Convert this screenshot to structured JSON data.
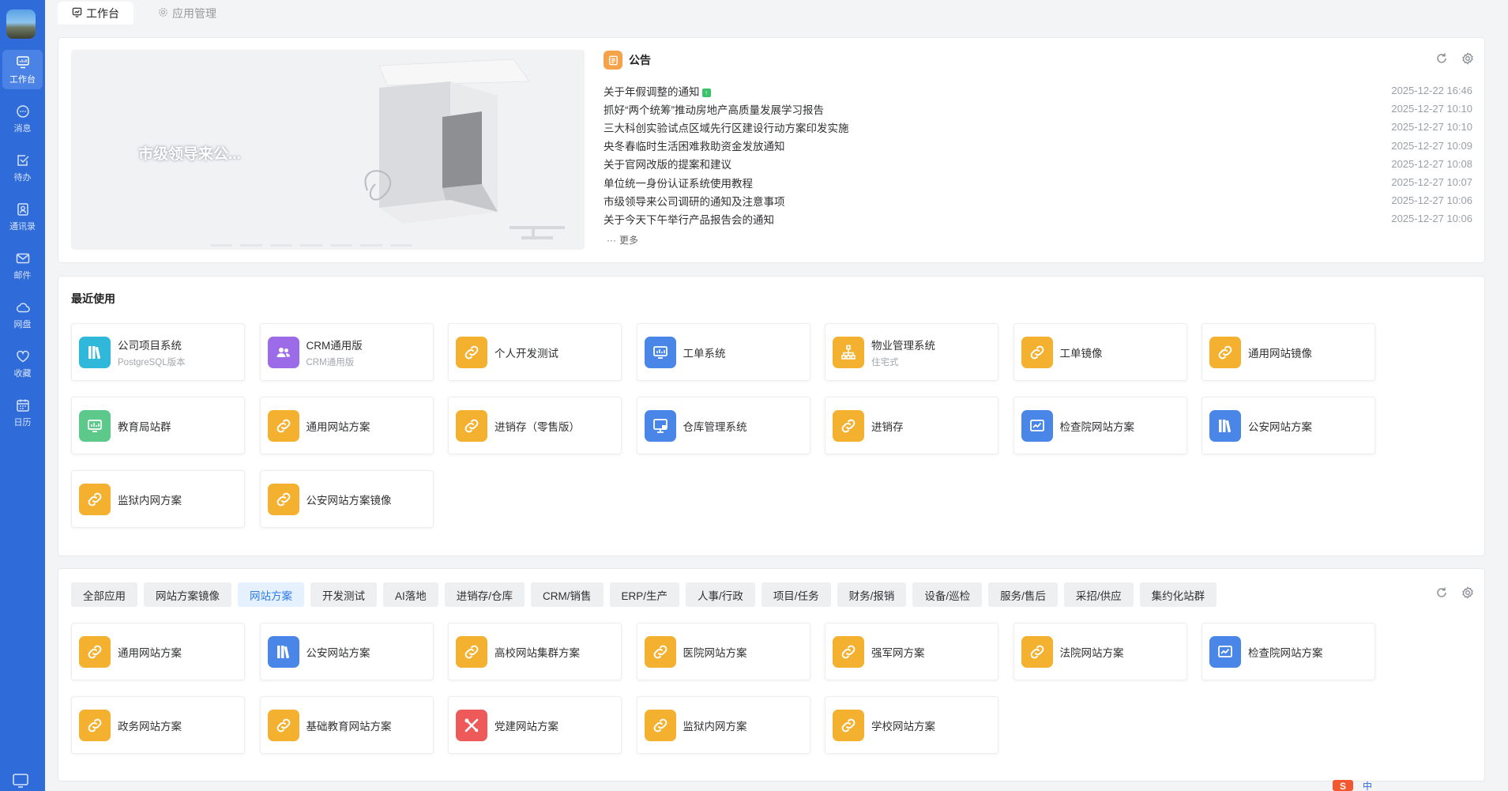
{
  "sidebar": {
    "items": [
      {
        "label": "工作台",
        "icon": "monitor-icon",
        "active": true
      },
      {
        "label": "消息",
        "icon": "message-icon"
      },
      {
        "label": "待办",
        "icon": "checkbox-icon"
      },
      {
        "label": "通讯录",
        "icon": "contacts-icon"
      },
      {
        "label": "邮件",
        "icon": "mail-icon"
      },
      {
        "label": "网盘",
        "icon": "cloud-icon"
      },
      {
        "label": "收藏",
        "icon": "heart-icon"
      },
      {
        "label": "日历",
        "icon": "calendar-icon"
      }
    ]
  },
  "tabs": [
    {
      "label": "工作台",
      "icon": "workbench-icon",
      "active": true
    },
    {
      "label": "应用管理",
      "icon": "gear-icon",
      "active": false
    }
  ],
  "banner": {
    "title": "市级领导来公..."
  },
  "notice": {
    "title": "公告",
    "more_label": "更多",
    "items": [
      {
        "title": "关于年假调整的通知",
        "date": "2025-12-22 16:46",
        "is_new": true
      },
      {
        "title": "抓好“两个统筹”推动房地产高质量发展学习报告",
        "date": "2025-12-27 10:10"
      },
      {
        "title": "三大科创实验试点区域先行区建设行动方案印发实施",
        "date": "2025-12-27 10:10"
      },
      {
        "title": "央冬春临时生活困难救助资金发放通知",
        "date": "2025-12-27 10:09"
      },
      {
        "title": "关于官网改版的提案和建议",
        "date": "2025-12-27 10:08"
      },
      {
        "title": "单位统一身份认证系统使用教程",
        "date": "2025-12-27 10:07"
      },
      {
        "title": "市级领导来公司调研的通知及注意事项",
        "date": "2025-12-27 10:06"
      },
      {
        "title": "关于今天下午举行产品报告会的通知",
        "date": "2025-12-27 10:06"
      }
    ]
  },
  "recent": {
    "title": "最近使用",
    "apps": [
      {
        "name": "公司项目系统",
        "sub": "PostgreSQL版本",
        "icon": "books-icon",
        "color": "#2fb8d9"
      },
      {
        "name": "CRM通用版",
        "sub": "CRM通用版",
        "icon": "users-icon",
        "color": "#9b6be8"
      },
      {
        "name": "个人开发测试",
        "sub": "",
        "icon": "link-icon",
        "color": "#f4b02f"
      },
      {
        "name": "工单系统",
        "sub": "",
        "icon": "monitor-icon",
        "color": "#4a86e8"
      },
      {
        "name": "物业管理系统",
        "sub": "住宅式",
        "icon": "org-icon",
        "color": "#f4b02f"
      },
      {
        "name": "工单镜像",
        "sub": "",
        "icon": "link-icon",
        "color": "#f4b02f"
      },
      {
        "name": "通用网站镜像",
        "sub": "",
        "icon": "link-icon",
        "color": "#f4b02f"
      },
      {
        "name": "教育局站群",
        "sub": "",
        "icon": "monitor-icon",
        "color": "#5cc98a"
      },
      {
        "name": "通用网站方案",
        "sub": "",
        "icon": "link-icon",
        "color": "#f4b02f"
      },
      {
        "name": "进销存（零售版）",
        "sub": "",
        "icon": "link-icon",
        "color": "#f4b02f"
      },
      {
        "name": "仓库管理系统",
        "sub": "",
        "icon": "screen-icon",
        "color": "#4a86e8"
      },
      {
        "name": "进销存",
        "sub": "",
        "icon": "link-icon",
        "color": "#f4b02f"
      },
      {
        "name": "检查院网站方案",
        "sub": "",
        "icon": "chart-icon",
        "color": "#4a86e8"
      },
      {
        "name": "公安网站方案",
        "sub": "",
        "icon": "books-icon",
        "color": "#4a86e8"
      },
      {
        "name": "监狱内网方案",
        "sub": "",
        "icon": "link-icon",
        "color": "#f4b02f"
      },
      {
        "name": "公安网站方案镜像",
        "sub": "",
        "icon": "link-icon",
        "color": "#f4b02f"
      }
    ]
  },
  "categories": {
    "chips": [
      "全部应用",
      "网站方案镜像",
      "网站方案",
      "开发测试",
      "AI落地",
      "进销存/仓库",
      "CRM/销售",
      "ERP/生产",
      "人事/行政",
      "项目/任务",
      "财务/报销",
      "设备/巡检",
      "服务/售后",
      "采招/供应",
      "集约化站群"
    ],
    "active_index": 2,
    "apps": [
      {
        "name": "通用网站方案",
        "icon": "link-icon",
        "color": "#f4b02f"
      },
      {
        "name": "公安网站方案",
        "icon": "books-icon",
        "color": "#4a86e8"
      },
      {
        "name": "高校网站集群方案",
        "icon": "link-icon",
        "color": "#f4b02f"
      },
      {
        "name": "医院网站方案",
        "icon": "link-icon",
        "color": "#f4b02f"
      },
      {
        "name": "强军网方案",
        "icon": "link-icon",
        "color": "#f4b02f"
      },
      {
        "name": "法院网站方案",
        "icon": "link-icon",
        "color": "#f4b02f"
      },
      {
        "name": "检查院网站方案",
        "icon": "chart-icon",
        "color": "#4a86e8"
      },
      {
        "name": "政务网站方案",
        "icon": "link-icon",
        "color": "#f4b02f"
      },
      {
        "name": "基础教育网站方案",
        "icon": "link-icon",
        "color": "#f4b02f"
      },
      {
        "name": "党建网站方案",
        "icon": "tools-icon",
        "color": "#ee5a5a"
      },
      {
        "name": "监狱内网方案",
        "icon": "link-icon",
        "color": "#f4b02f"
      },
      {
        "name": "学校网站方案",
        "icon": "link-icon",
        "color": "#f4b02f"
      }
    ]
  },
  "tray": {
    "ime_label": "中"
  }
}
